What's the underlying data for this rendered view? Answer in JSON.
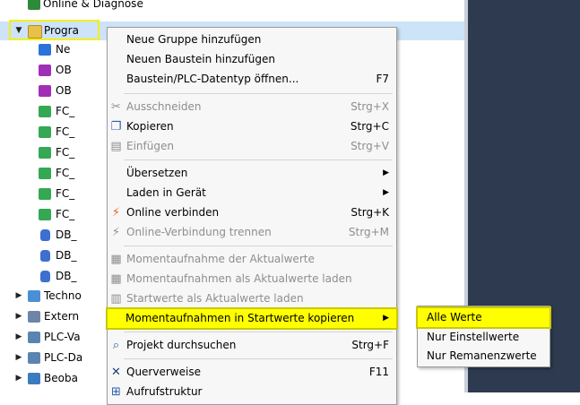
{
  "tree": {
    "top_partial_label": "Online & Diagnose",
    "items": [
      {
        "label": "Progra",
        "icon": "folder-program-blocks-icon"
      },
      {
        "label": "Ne",
        "icon": "add-new-block-icon"
      },
      {
        "label": "OB",
        "icon": "ob-block-icon"
      },
      {
        "label": "OB",
        "icon": "ob-block-icon"
      },
      {
        "label": "FC_",
        "icon": "fc-block-icon"
      },
      {
        "label": "FC_",
        "icon": "fc-block-icon"
      },
      {
        "label": "FC_",
        "icon": "fc-block-icon"
      },
      {
        "label": "FC_",
        "icon": "fc-block-icon"
      },
      {
        "label": "FC_",
        "icon": "fc-block-icon"
      },
      {
        "label": "FC_",
        "icon": "fc-block-icon"
      },
      {
        "label": "DB_",
        "icon": "db-block-icon"
      },
      {
        "label": "DB_",
        "icon": "db-block-icon"
      },
      {
        "label": "DB_",
        "icon": "db-block-icon"
      },
      {
        "label": "Techno",
        "icon": "technology-objects-icon"
      },
      {
        "label": "Extern",
        "icon": "external-sources-icon"
      },
      {
        "label": "PLC-Va",
        "icon": "plc-variables-icon"
      },
      {
        "label": "PLC-Da",
        "icon": "plc-datatypes-icon"
      },
      {
        "label": "Beoba",
        "icon": "watch-tables-icon"
      }
    ]
  },
  "menu": {
    "items": [
      {
        "label": "Neue Gruppe hinzufügen",
        "shortcut": ""
      },
      {
        "label": "Neuen Baustein hinzufügen",
        "shortcut": ""
      },
      {
        "label": "Baustein/PLC-Datentyp öffnen...",
        "shortcut": "F7"
      },
      {
        "label": "Ausschneiden",
        "shortcut": "Strg+X"
      },
      {
        "label": "Kopieren",
        "shortcut": "Strg+C"
      },
      {
        "label": "Einfügen",
        "shortcut": "Strg+V"
      },
      {
        "label": "Übersetzen",
        "shortcut": ""
      },
      {
        "label": "Laden in Gerät",
        "shortcut": ""
      },
      {
        "label": "Online verbinden",
        "shortcut": "Strg+K"
      },
      {
        "label": "Online-Verbindung trennen",
        "shortcut": "Strg+M"
      },
      {
        "label": "Momentaufnahme der Aktualwerte",
        "shortcut": ""
      },
      {
        "label": "Momentaufnahmen als Aktualwerte laden",
        "shortcut": ""
      },
      {
        "label": "Startwerte als Aktualwerte laden",
        "shortcut": ""
      },
      {
        "label": "Momentaufnahmen in Startwerte kopieren",
        "shortcut": ""
      },
      {
        "label": "Projekt durchsuchen",
        "shortcut": "Strg+F"
      },
      {
        "label": "Querverweise",
        "shortcut": "F11"
      },
      {
        "label": "Aufrufstruktur",
        "shortcut": ""
      }
    ]
  },
  "submenu": {
    "items": [
      {
        "label": "Alle Werte"
      },
      {
        "label": "Nur Einstellwerte"
      },
      {
        "label": "Nur Remanenzwerte"
      }
    ]
  },
  "colors": {
    "highlight": "#ffff00",
    "selection": "#cde3f7",
    "dark_panel": "#2d3a4f"
  }
}
